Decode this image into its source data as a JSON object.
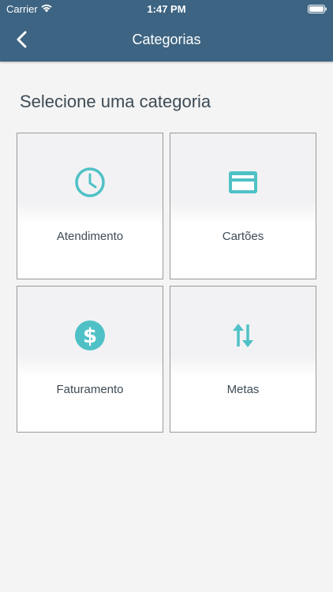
{
  "status_bar": {
    "carrier": "Carrier",
    "time": "1:47 PM"
  },
  "nav": {
    "title": "Categorias",
    "back_icon": "chevron-left-icon"
  },
  "section": {
    "title": "Selecione uma categoria"
  },
  "categories": [
    {
      "label": "Atendimento",
      "icon": "clock-icon"
    },
    {
      "label": "Cartões",
      "icon": "credit-card-icon"
    },
    {
      "label": "Faturamento",
      "icon": "dollar-icon"
    },
    {
      "label": "Metas",
      "icon": "swap-vertical-icon"
    }
  ],
  "colors": {
    "header_background": "#3d6482",
    "accent": "#4fc1c6",
    "text": "#3e4b55",
    "background": "#f4f4f4"
  }
}
